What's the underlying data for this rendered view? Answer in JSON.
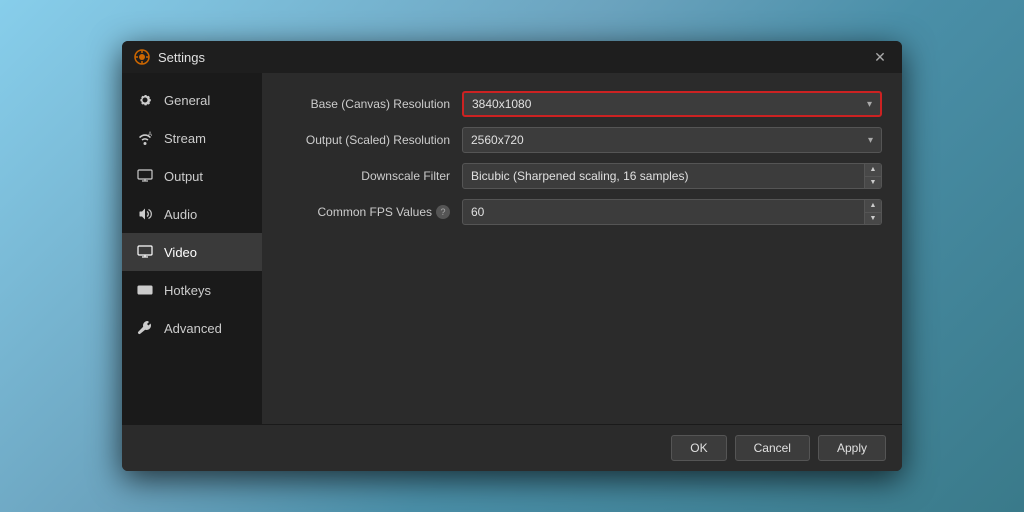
{
  "dialog": {
    "title": "Settings",
    "close_label": "✕"
  },
  "sidebar": {
    "items": [
      {
        "id": "general",
        "label": "General",
        "icon": "gear"
      },
      {
        "id": "stream",
        "label": "Stream",
        "icon": "wifi"
      },
      {
        "id": "output",
        "label": "Output",
        "icon": "monitor-out"
      },
      {
        "id": "audio",
        "label": "Audio",
        "icon": "speaker"
      },
      {
        "id": "video",
        "label": "Video",
        "icon": "monitor",
        "active": true
      },
      {
        "id": "hotkeys",
        "label": "Hotkeys",
        "icon": "keyboard"
      },
      {
        "id": "advanced",
        "label": "Advanced",
        "icon": "wrench"
      }
    ]
  },
  "video_settings": {
    "base_resolution_label": "Base (Canvas) Resolution",
    "base_resolution_value": "3840x1080",
    "output_resolution_label": "Output (Scaled) Resolution",
    "output_resolution_value": "2560x720",
    "downscale_filter_label": "Downscale Filter",
    "downscale_filter_value": "Bicubic (Sharpened scaling, 16 samples)",
    "fps_label": "Common FPS Values",
    "fps_value": "60"
  },
  "footer": {
    "ok_label": "OK",
    "cancel_label": "Cancel",
    "apply_label": "Apply"
  }
}
